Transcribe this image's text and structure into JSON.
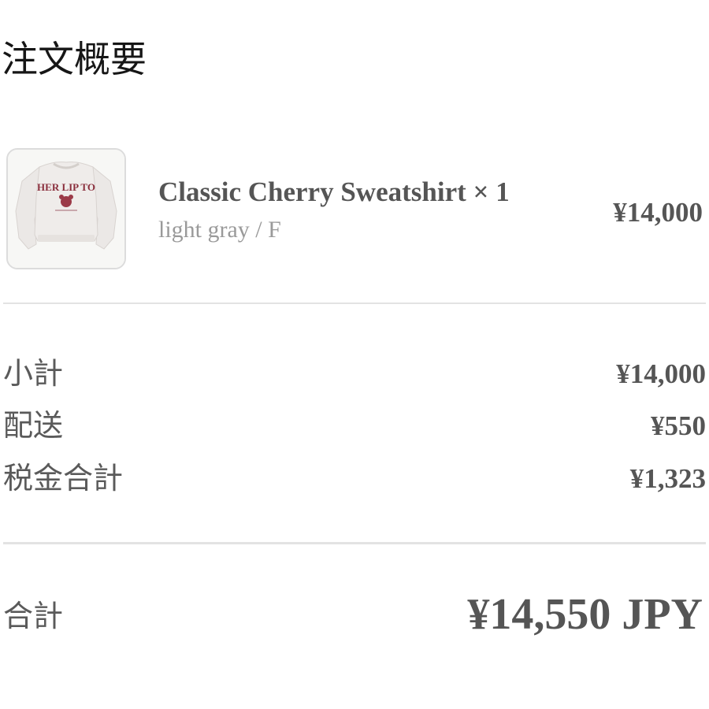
{
  "header": {
    "title": "注文概要"
  },
  "product": {
    "image_icon": "sweatshirt-thumbnail",
    "image_print_text": "HER LIP TO",
    "name": "Classic Cherry Sweatshirt × 1",
    "variant": "light gray / F",
    "price": "¥14,000"
  },
  "summary": {
    "subtotal_label": "小計",
    "subtotal_value": "¥14,000",
    "shipping_label": "配送",
    "shipping_value": "¥550",
    "tax_label": "税金合計",
    "tax_value": "¥1,323"
  },
  "total": {
    "label": "合計",
    "value": "¥14,550 JPY"
  },
  "colors": {
    "title_text": "#161616",
    "body_text": "#555555",
    "muted_text": "#9a9a9a",
    "divider": "#e3e3e3",
    "print_accent": "#8a2e3c"
  }
}
